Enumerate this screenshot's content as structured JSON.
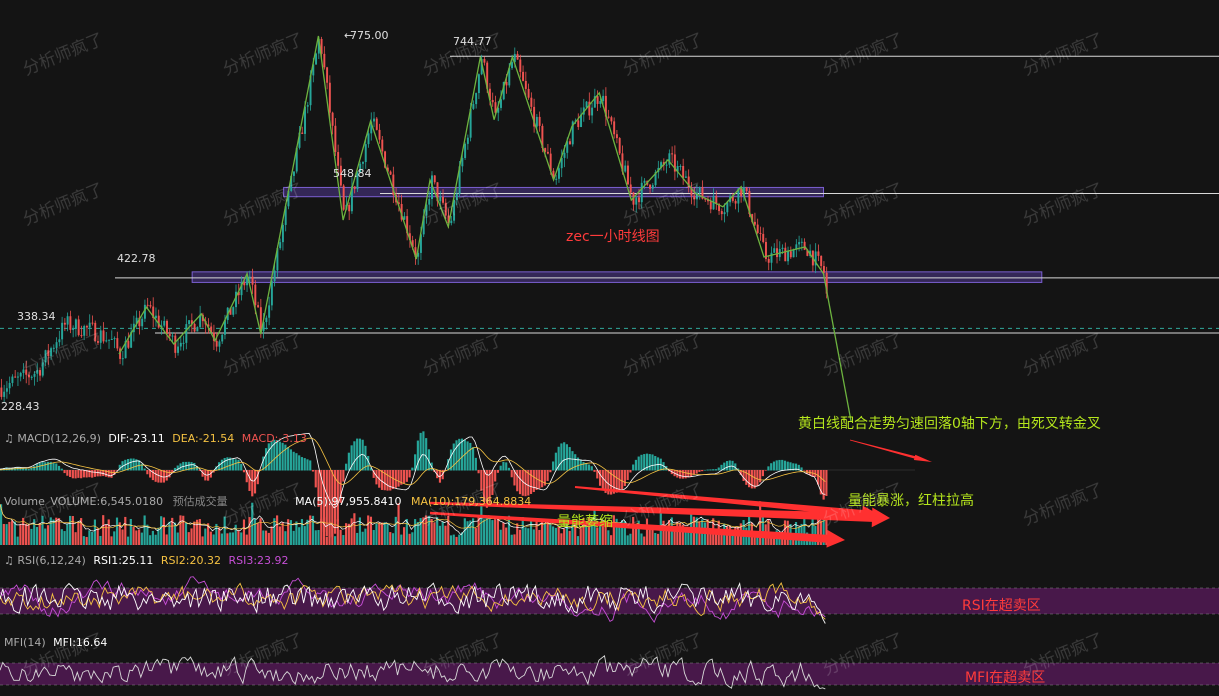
{
  "chart_data": {
    "type": "candlestick",
    "title": "zec一小时线图",
    "price_levels": {
      "high": "775.00",
      "secondary_high": "744.77",
      "mid": "548.84",
      "support": "422.78",
      "current": "338.34",
      "low": "228.43"
    },
    "price_range": [
      228.43,
      775.0
    ],
    "zigzag_path": [
      {
        "t": 0.13,
        "p": 300
      },
      {
        "t": 0.16,
        "p": 370
      },
      {
        "t": 0.19,
        "p": 315
      },
      {
        "t": 0.22,
        "p": 360
      },
      {
        "t": 0.235,
        "p": 320
      },
      {
        "t": 0.27,
        "p": 420
      },
      {
        "t": 0.285,
        "p": 330
      },
      {
        "t": 0.348,
        "p": 775
      },
      {
        "t": 0.375,
        "p": 500
      },
      {
        "t": 0.405,
        "p": 648
      },
      {
        "t": 0.455,
        "p": 442
      },
      {
        "t": 0.47,
        "p": 560
      },
      {
        "t": 0.49,
        "p": 490
      },
      {
        "t": 0.525,
        "p": 744
      },
      {
        "t": 0.54,
        "p": 650
      },
      {
        "t": 0.56,
        "p": 744
      },
      {
        "t": 0.605,
        "p": 560
      },
      {
        "t": 0.625,
        "p": 640
      },
      {
        "t": 0.655,
        "p": 690
      },
      {
        "t": 0.69,
        "p": 530
      },
      {
        "t": 0.73,
        "p": 590
      },
      {
        "t": 0.76,
        "p": 540
      },
      {
        "t": 0.79,
        "p": 520
      },
      {
        "t": 0.81,
        "p": 550
      },
      {
        "t": 0.835,
        "p": 445
      },
      {
        "t": 0.88,
        "p": 460
      },
      {
        "t": 0.9,
        "p": 420
      },
      {
        "t": 0.93,
        "p": 200
      }
    ],
    "zones": [
      {
        "from": 535,
        "to": 548.84,
        "x_start": 0.31,
        "x_end": 0.9
      },
      {
        "from": 407,
        "to": 422.78,
        "x_start": 0.21,
        "x_end": 0.92
      }
    ],
    "annotations": [
      "黄白线配合走势匀速回落0轴下方，由死叉转金叉",
      "量能暴涨，红柱拉高",
      "量能萎缩",
      "RSI在超卖区",
      "MFI在超卖区"
    ],
    "indicators": {
      "macd": {
        "name": "MACD(12,26,9)",
        "dif_label": "DIF:-23.11",
        "dea_label": "DEA:-21.54",
        "macd_label": "MACD:-3.13",
        "dif": -23.11,
        "dea": -21.54,
        "macd": -3.13
      },
      "volume": {
        "name": "Volume",
        "volume_label": "VOLUME:6,545.0180",
        "est_label": "预估成交量",
        "ma5_label": "MA(5):97,955.8410",
        "ma10_label": "MA(10):179,364.8834"
      },
      "rsi": {
        "name": "RSI(6,12,24)",
        "rsi1_label": "RSI1:25.11",
        "rsi2_label": "RSI2:20.32",
        "rsi3_label": "RSI3:23.92"
      },
      "mfi": {
        "name": "MFI(14)",
        "mfi_label": "MFI:16.64"
      }
    },
    "colors": {
      "up": "#26a69a",
      "down": "#ef5350",
      "zigzag": "#6db33f",
      "zone": "#5b3fa8",
      "annotation_green": "#b5e61d",
      "annotation_red": "#ff4040",
      "arrow": "#ff3030",
      "title_red": "#ff3b3b",
      "dif": "#ffffff",
      "dea": "#f5c242",
      "rsi1": "#ffffff",
      "rsi2": "#f5c242",
      "rsi3": "#c64fd6",
      "oversold_band": "#5a1a5c"
    }
  },
  "watermark": "分析师疯了"
}
